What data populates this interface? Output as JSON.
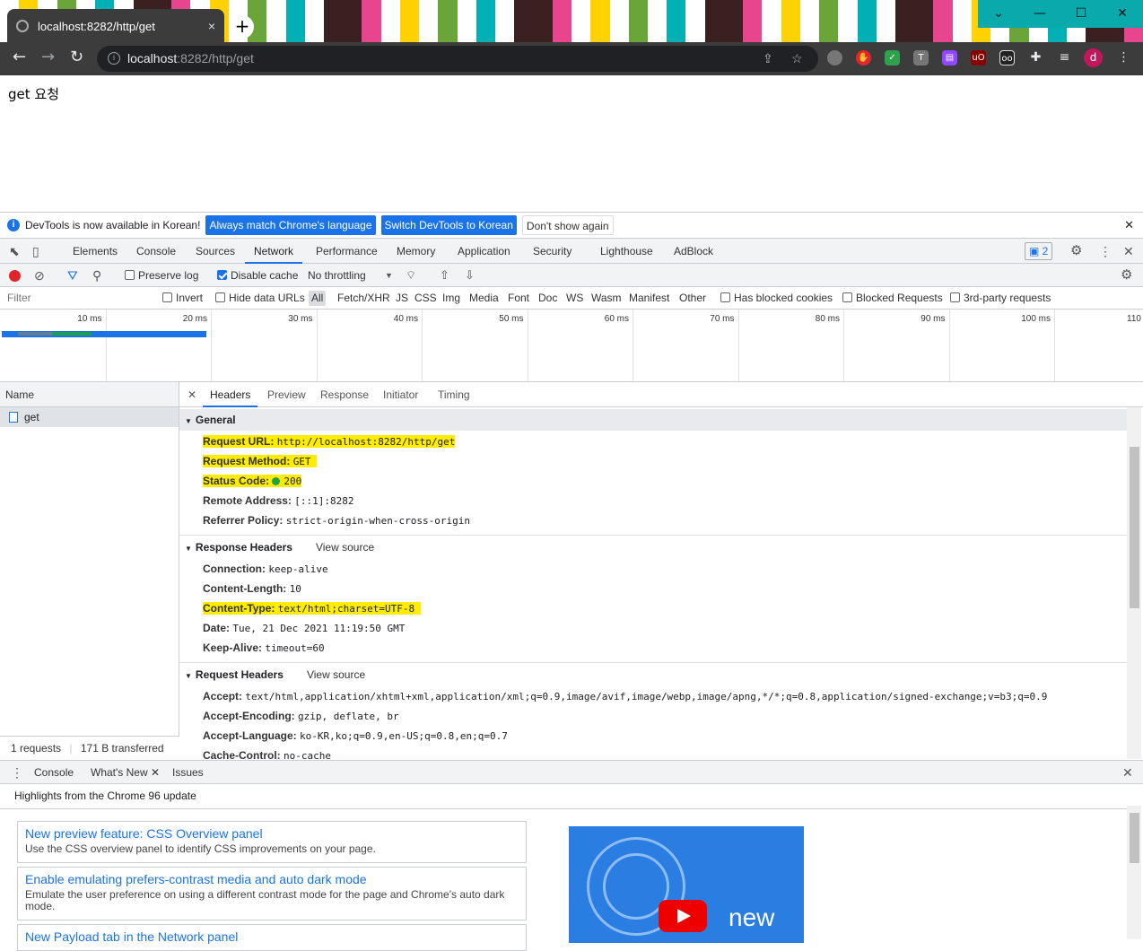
{
  "browser": {
    "tab_title": "localhost:8282/http/get",
    "tab_close": "×",
    "new_tab": "+",
    "url_host": "localhost",
    "url_path": ":8282/http/get",
    "win_controls": [
      "⌄",
      "—",
      "☐",
      "✕"
    ]
  },
  "page": {
    "body_text": "get 요청"
  },
  "infobar": {
    "message": "DevTools is now available in Korean!",
    "btn_match": "Always match Chrome's language",
    "btn_switch": "Switch DevTools to Korean",
    "btn_dont": "Don't show again"
  },
  "devtools_tabs": [
    "Elements",
    "Console",
    "Sources",
    "Network",
    "Performance",
    "Memory",
    "Application",
    "Security",
    "Lighthouse",
    "AdBlock"
  ],
  "issues_count": "2",
  "network_toolbar": {
    "preserve_log": "Preserve log",
    "disable_cache": "Disable cache",
    "throttling": "No throttling"
  },
  "filter": {
    "placeholder": "Filter",
    "invert": "Invert",
    "hide_data_urls": "Hide data URLs",
    "types": [
      "All",
      "Fetch/XHR",
      "JS",
      "CSS",
      "Img",
      "Media",
      "Font",
      "Doc",
      "WS",
      "Wasm",
      "Manifest",
      "Other"
    ],
    "has_blocked": "Has blocked cookies",
    "blocked_requests": "Blocked Requests",
    "third_party": "3rd-party requests"
  },
  "timeline_labels": [
    "10 ms",
    "20 ms",
    "30 ms",
    "40 ms",
    "50 ms",
    "60 ms",
    "70 ms",
    "80 ms",
    "90 ms",
    "100 ms",
    "110"
  ],
  "requests": {
    "header": "Name",
    "rows": [
      "get"
    ],
    "footer_count": "1 requests",
    "footer_transferred": "171 B transferred"
  },
  "detail_tabs": [
    "Headers",
    "Preview",
    "Response",
    "Initiator",
    "Timing"
  ],
  "general": {
    "title": "General",
    "rows": [
      {
        "k": "Request URL:",
        "v": "http://localhost:8282/http/get"
      },
      {
        "k": "Request Method:",
        "v": "GET"
      },
      {
        "k": "Status Code:",
        "v": "200"
      },
      {
        "k": "Remote Address:",
        "v": "[::1]:8282"
      },
      {
        "k": "Referrer Policy:",
        "v": "strict-origin-when-cross-origin"
      }
    ]
  },
  "response_headers": {
    "title": "Response Headers",
    "view_source": "View source",
    "rows": [
      {
        "k": "Connection:",
        "v": "keep-alive"
      },
      {
        "k": "Content-Length:",
        "v": "10"
      },
      {
        "k": "Content-Type:",
        "v": "text/html;charset=UTF-8"
      },
      {
        "k": "Date:",
        "v": "Tue, 21 Dec 2021 11:19:50 GMT"
      },
      {
        "k": "Keep-Alive:",
        "v": "timeout=60"
      }
    ]
  },
  "request_headers": {
    "title": "Request Headers",
    "view_source": "View source",
    "rows": [
      {
        "k": "Accept:",
        "v": "text/html,application/xhtml+xml,application/xml;q=0.9,image/avif,image/webp,image/apng,*/*;q=0.8,application/signed-exchange;v=b3;q=0.9"
      },
      {
        "k": "Accept-Encoding:",
        "v": "gzip, deflate, br"
      },
      {
        "k": "Accept-Language:",
        "v": "ko-KR,ko;q=0.9,en-US;q=0.8,en;q=0.7"
      },
      {
        "k": "Cache-Control:",
        "v": "no-cache"
      }
    ]
  },
  "drawer": {
    "tabs": [
      "Console",
      "What's New",
      "Issues"
    ],
    "highlights": "Highlights from the Chrome 96 update",
    "cards": [
      {
        "title": "New preview feature: CSS Overview panel",
        "desc": "Use the CSS overview panel to identify CSS improvements on your page."
      },
      {
        "title": "Enable emulating prefers-contrast media and auto dark mode",
        "desc": "Emulate the user preference on using a different contrast mode for the page and Chrome's auto dark mode."
      },
      {
        "title": "New Payload tab in the Network panel",
        "desc": ""
      }
    ],
    "promo_text": "new"
  },
  "colors": {
    "accent": "#1a73e8",
    "highlight": "#ffed00",
    "toolbar": "#3c3c3c",
    "winctl": "#0aa9ac"
  }
}
